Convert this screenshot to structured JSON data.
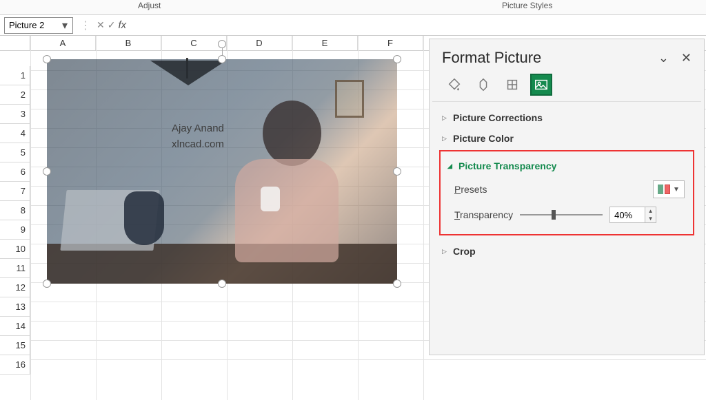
{
  "ribbon": {
    "group_adjust": "Adjust",
    "group_picture_styles": "Picture Styles"
  },
  "namebox": {
    "value": "Picture 2"
  },
  "formula": {
    "fx": "fx",
    "cancel_glyph": "✕",
    "enter_glyph": "✓",
    "sep_glyph": "⋮",
    "value": ""
  },
  "grid": {
    "cols": [
      "A",
      "B",
      "C",
      "D",
      "E",
      "F"
    ],
    "row_count": 16
  },
  "picture_overlay": {
    "line1": "Ajay Anand",
    "line2": "xlncad.com"
  },
  "pane": {
    "title": "Format Picture",
    "collapse_glyph": "⌄",
    "close_glyph": "✕",
    "sections": {
      "corrections": "Picture Corrections",
      "color": "Picture Color",
      "transparency": "Picture Transparency",
      "crop": "Crop"
    },
    "transparency": {
      "presets_label_pre": "P",
      "presets_label_rest": "resets",
      "label_pre": "T",
      "label_rest": "ransparency",
      "value": "40%",
      "slider_percent": 40
    }
  }
}
